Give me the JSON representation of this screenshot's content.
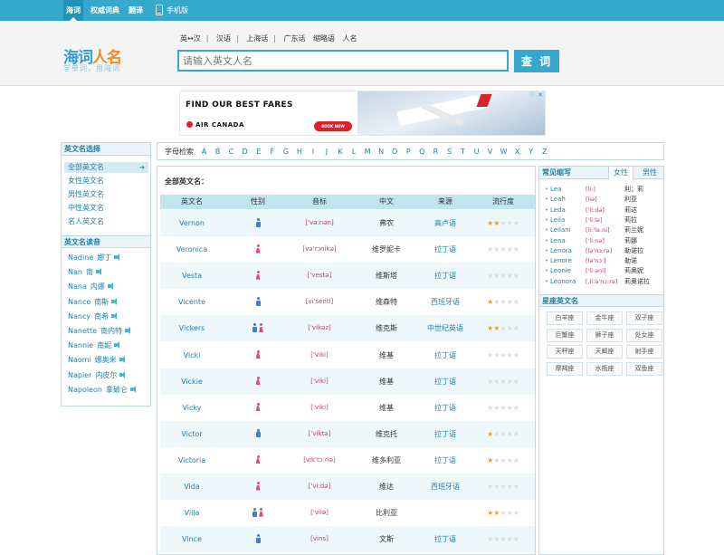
{
  "topnav": {
    "tabs": [
      {
        "label": "海词",
        "active": true
      },
      {
        "label": "权威词典",
        "active": false
      },
      {
        "label": "翻译",
        "active": false
      },
      {
        "label": "手机版",
        "active": false
      }
    ]
  },
  "header": {
    "logo_main_blue": "海词",
    "logo_main_orange": "人名",
    "logo_slogan": "学单词，用海词",
    "langs": [
      "英↔汉",
      "汉语",
      "上海话",
      "广东话",
      "缩略语",
      "人名"
    ],
    "separators": [
      "|",
      "|",
      "|"
    ],
    "search_placeholder": "请输入英文人名",
    "search_button": "查 词"
  },
  "ad": {
    "title": "FIND OUR BEST FARES",
    "brand": "AIR CANADA",
    "cta": "BOOK NOW",
    "info": "ⓘ",
    "close": "✕"
  },
  "sidebar": {
    "category_title": "英文名选择",
    "categories": [
      {
        "label": "全部英文名",
        "active": true
      },
      {
        "label": "女性英文名",
        "active": false
      },
      {
        "label": "男性英文名",
        "active": false
      },
      {
        "label": "中性英文名",
        "active": false
      },
      {
        "label": "名人英文名",
        "active": false
      }
    ],
    "reading_title": "英文名读音",
    "names": [
      {
        "en": "Nadine",
        "cn": "娜丁"
      },
      {
        "en": "Nan",
        "cn": "南"
      },
      {
        "en": "Nana",
        "cn": "内娜"
      },
      {
        "en": "Nance",
        "cn": "南斯"
      },
      {
        "en": "Nancy",
        "cn": "南希"
      },
      {
        "en": "Nanette",
        "cn": "南内特"
      },
      {
        "en": "Nannie",
        "cn": "南妮"
      },
      {
        "en": "Naomi",
        "cn": "娜奥米"
      },
      {
        "en": "Napier",
        "cn": "内皮尔"
      },
      {
        "en": "Napoleon",
        "cn": "拿破仑"
      }
    ]
  },
  "alphabet": {
    "label": "字母检索",
    "letters": [
      "A",
      "B",
      "C",
      "D",
      "E",
      "F",
      "G",
      "H",
      "I",
      "J",
      "K",
      "L",
      "M",
      "N",
      "O",
      "P",
      "Q",
      "R",
      "S",
      "T",
      "U",
      "V",
      "W",
      "X",
      "Y",
      "Z"
    ]
  },
  "main": {
    "title": "全部英文名：",
    "columns": [
      "英文名",
      "性别",
      "音标",
      "中文",
      "来源",
      "流行度"
    ],
    "rows": [
      {
        "name": "Vernon",
        "gender": "m",
        "ipa": "['və:nən]",
        "cn": "弗农",
        "src": "高卢语",
        "pop": 2
      },
      {
        "name": "Veronica",
        "gender": "f",
        "ipa": "[və'rɔnikə]",
        "cn": "维罗妮卡",
        "src": "拉丁语",
        "pop": 0
      },
      {
        "name": "Vesta",
        "gender": "f",
        "ipa": "['vestə]",
        "cn": "维斯塔",
        "src": "拉丁语",
        "pop": 0
      },
      {
        "name": "Vicente",
        "gender": "m",
        "ipa": "[vi'senti]",
        "cn": "维森特",
        "src": "西班牙语",
        "pop": 1
      },
      {
        "name": "Vickers",
        "gender": "mf",
        "ipa": "['vikəz]",
        "cn": "维克斯",
        "src": "中世纪英语",
        "pop": 2
      },
      {
        "name": "Vicki",
        "gender": "f",
        "ipa": "['viki]",
        "cn": "维基",
        "src": "拉丁语",
        "pop": 0
      },
      {
        "name": "Vickie",
        "gender": "f",
        "ipa": "['viki]",
        "cn": "维基",
        "src": "拉丁语",
        "pop": 0
      },
      {
        "name": "Vicky",
        "gender": "f",
        "ipa": "['viki]",
        "cn": "维基",
        "src": "拉丁语",
        "pop": 0
      },
      {
        "name": "Victor",
        "gender": "m",
        "ipa": "['viktə]",
        "cn": "维克托",
        "src": "拉丁语",
        "pop": 1
      },
      {
        "name": "Victoria",
        "gender": "f",
        "ipa": "[vik'tɔ:riə]",
        "cn": "维多利亚",
        "src": "拉丁语",
        "pop": 1
      },
      {
        "name": "Vida",
        "gender": "f",
        "ipa": "['vi:də]",
        "cn": "维达",
        "src": "西班牙语",
        "pop": 0
      },
      {
        "name": "Villa",
        "gender": "mf",
        "ipa": "['vilə]",
        "cn": "比利亚",
        "src": "",
        "pop": 2
      },
      {
        "name": "Vince",
        "gender": "m",
        "ipa": "[vins]",
        "cn": "文斯",
        "src": "拉丁语",
        "pop": 0
      }
    ]
  },
  "right": {
    "abbr_title": "常见缩写",
    "tabs": [
      {
        "label": "女性",
        "active": true
      },
      {
        "label": "男性",
        "active": false
      }
    ],
    "abbr_bullet": "•",
    "abbrs": [
      {
        "en": "Lea",
        "ipa": "[li:]",
        "cn": "利；莉"
      },
      {
        "en": "Leah",
        "ipa": "[liə]",
        "cn": "利亚"
      },
      {
        "en": "Leda",
        "ipa": "['li:də]",
        "cn": "莉达"
      },
      {
        "en": "Leila",
        "ipa": "['li:lə]",
        "cn": "莉拉"
      },
      {
        "en": "Leilani",
        "ipa": "[li:'la:ni]",
        "cn": "莉兰妮"
      },
      {
        "en": "Lena",
        "ipa": "['li:nə]",
        "cn": "莉娜"
      },
      {
        "en": "Lenora",
        "ipa": "[lə'nɔ:rə]",
        "cn": "勒诺拉"
      },
      {
        "en": "Lenore",
        "ipa": "[lə'nɔ:]",
        "cn": "勒诺"
      },
      {
        "en": "Leonie",
        "ipa": "['li:əni]",
        "cn": "莉奥妮"
      },
      {
        "en": "Leonora",
        "ipa": "[,li:ə'nɔ:rə]",
        "cn": "莉奥诺拉"
      }
    ],
    "zodiac_title": "星座英文名",
    "zodiacs": [
      "白羊座",
      "金牛座",
      "双子座",
      "巨蟹座",
      "狮子座",
      "处女座",
      "天秤座",
      "天蝎座",
      "射手座",
      "摩羯座",
      "水瓶座",
      "双鱼座"
    ]
  }
}
